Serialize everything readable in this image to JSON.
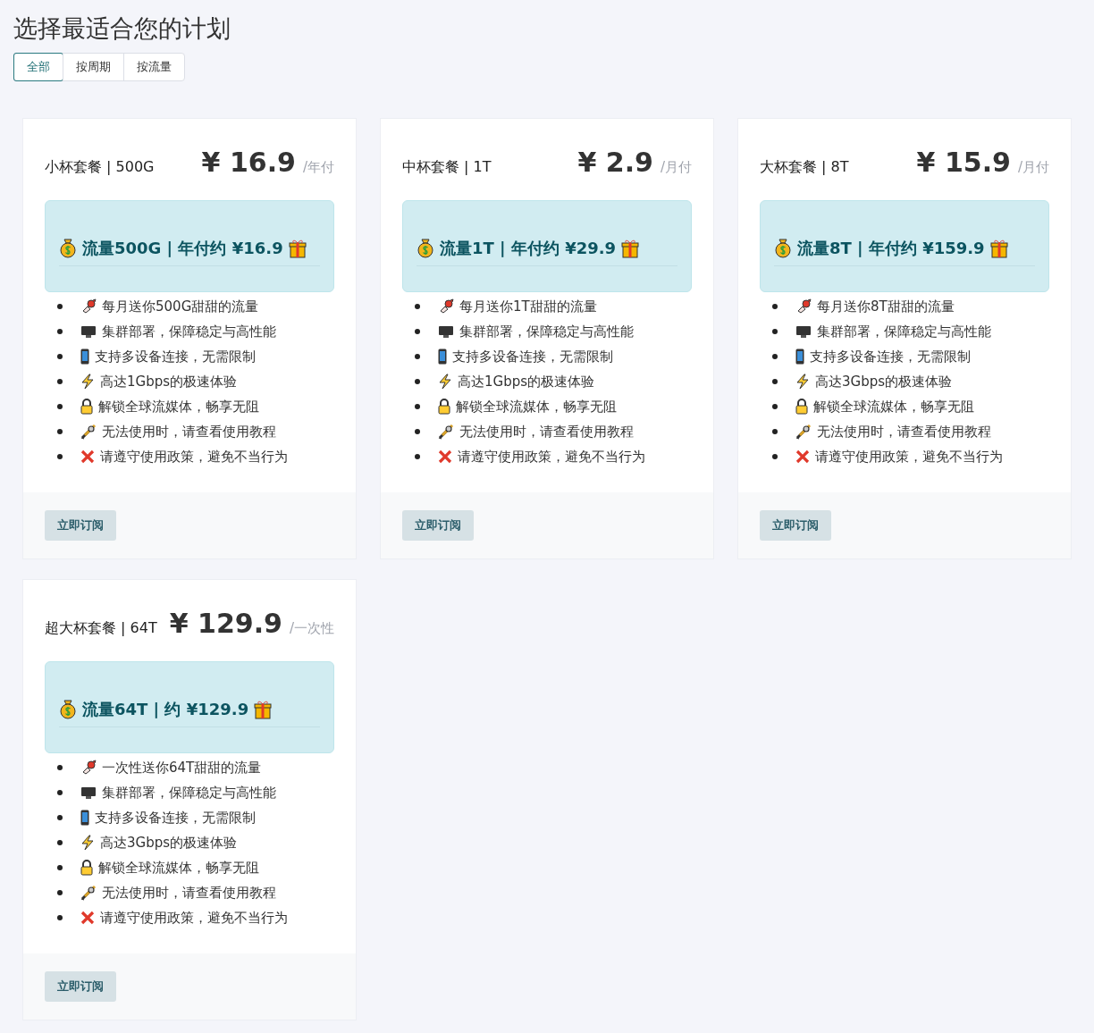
{
  "title": "选择最适合您的计划",
  "tabs": [
    {
      "label": "全部",
      "selected": true
    },
    {
      "label": "按周期",
      "selected": false
    },
    {
      "label": "按流量",
      "selected": false
    }
  ],
  "plans": [
    {
      "name": "小杯套餐 | 500G",
      "price": "¥ 16.9",
      "period": "/年付",
      "highlight": "流量500G | 年付约 ¥16.9",
      "features": [
        "每月送你500G甜甜的流量",
        "集群部署，保障稳定与高性能",
        "支持多设备连接，无需限制",
        "高达1Gbps的极速体验",
        "解锁全球流媒体，畅享无阻",
        "无法使用时，请查看使用教程",
        "请遵守使用政策，避免不当行为"
      ],
      "button": "立即订阅"
    },
    {
      "name": "中杯套餐 | 1T",
      "price": "¥ 2.9",
      "period": "/月付",
      "highlight": "流量1T | 年付约 ¥29.9",
      "features": [
        "每月送你1T甜甜的流量",
        "集群部署，保障稳定与高性能",
        "支持多设备连接，无需限制",
        "高达1Gbps的极速体验",
        "解锁全球流媒体，畅享无阻",
        "无法使用时，请查看使用教程",
        "请遵守使用政策，避免不当行为"
      ],
      "button": "立即订阅"
    },
    {
      "name": "大杯套餐 | 8T",
      "price": "¥ 15.9",
      "period": "/月付",
      "highlight": "流量8T | 年付约 ¥159.9",
      "features": [
        "每月送你8T甜甜的流量",
        "集群部署，保障稳定与高性能",
        "支持多设备连接，无需限制",
        "高达3Gbps的极速体验",
        "解锁全球流媒体，畅享无阻",
        "无法使用时，请查看使用教程",
        "请遵守使用政策，避免不当行为"
      ],
      "button": "立即订阅"
    },
    {
      "name": "超大杯套餐 | 64T",
      "price": "¥ 129.9",
      "period": "/一次性",
      "highlight": "流量64T | 约 ¥129.9",
      "features": [
        "一次性送你64T甜甜的流量",
        "集群部署，保障稳定与高性能",
        "支持多设备连接，无需限制",
        "高达3Gbps的极速体验",
        "解锁全球流媒体，畅享无阻",
        "无法使用时，请查看使用教程",
        "请遵守使用政策，避免不当行为"
      ],
      "button": "立即订阅"
    }
  ]
}
